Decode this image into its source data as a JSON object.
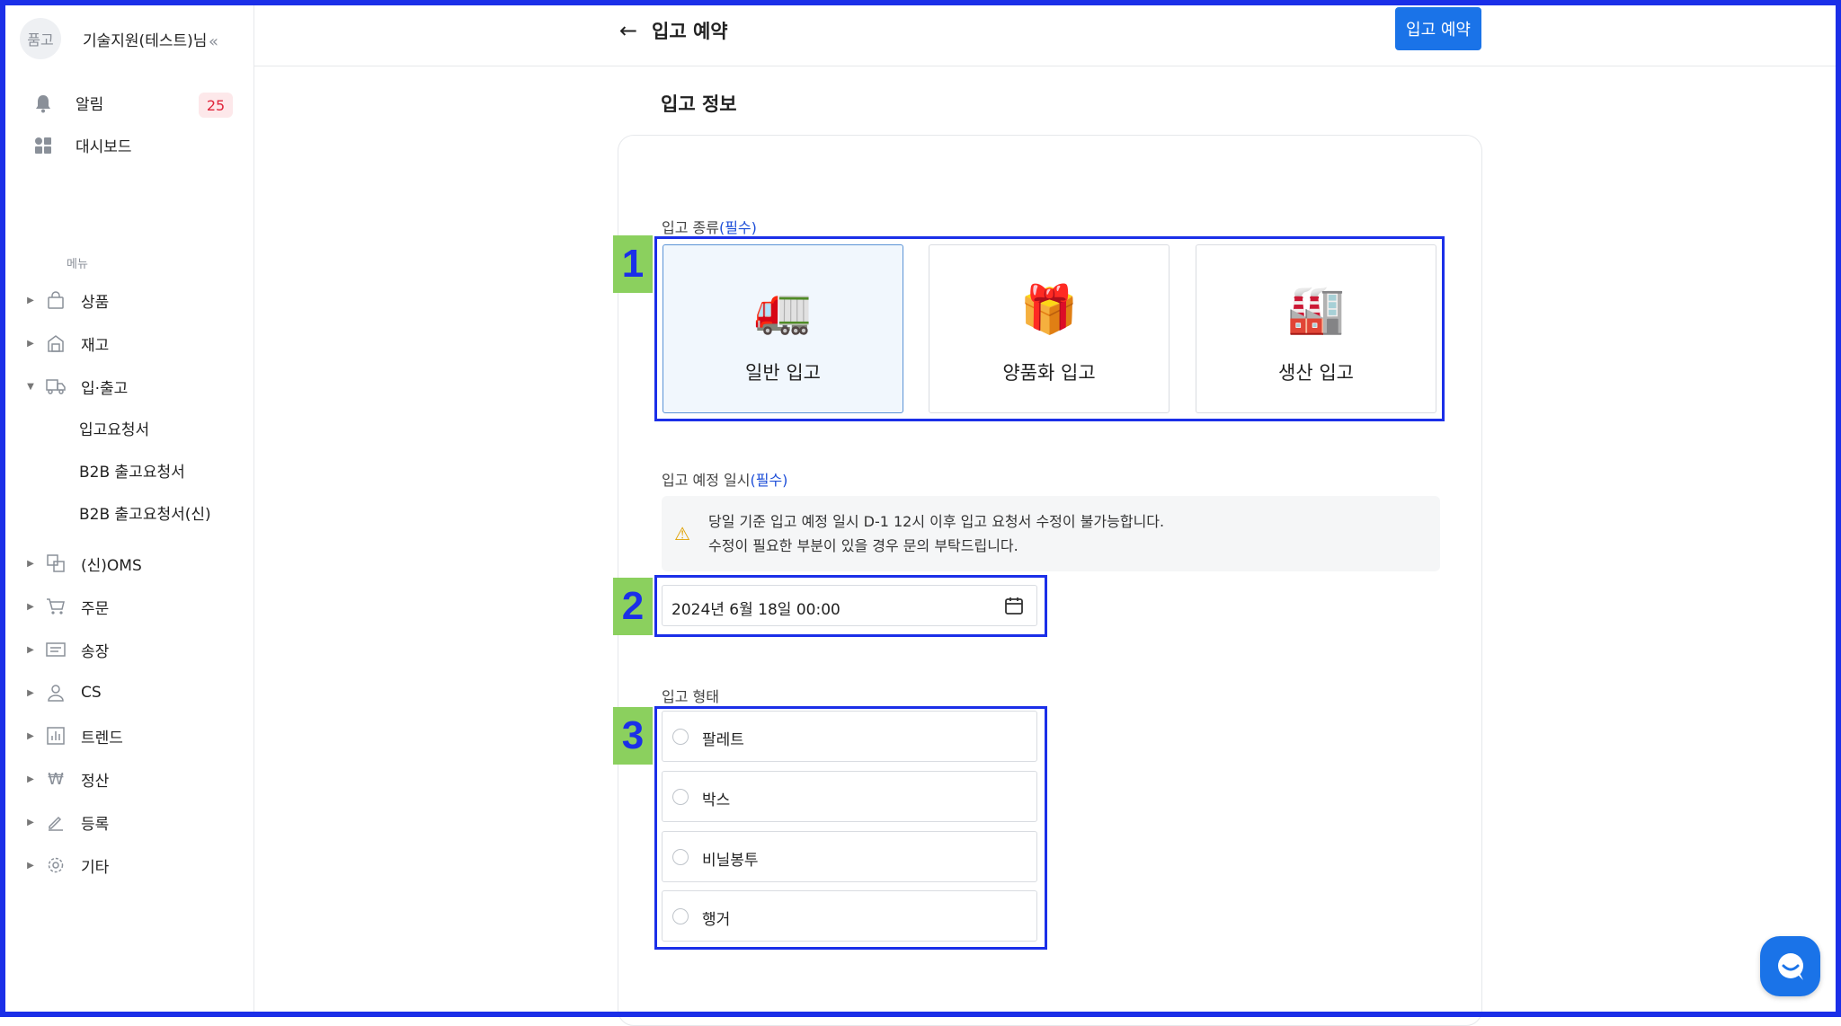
{
  "sidebar": {
    "avatar_text": "품고",
    "user_name": "기술지원(테스트)님",
    "collapse_icon": "double-chevron-left-icon",
    "notifications": {
      "label": "알림",
      "count": "25"
    },
    "dashboard": {
      "label": "대시보드"
    },
    "menu_section": "메뉴",
    "items": [
      {
        "label": "상품",
        "icon": "bag-icon"
      },
      {
        "label": "재고",
        "icon": "warehouse-icon"
      },
      {
        "label": "입·출고",
        "icon": "truck-icon",
        "expanded": true
      },
      {
        "label": "(신)OMS",
        "icon": "oms-icon"
      },
      {
        "label": "주문",
        "icon": "cart-icon"
      },
      {
        "label": "송장",
        "icon": "invoice-icon"
      },
      {
        "label": "CS",
        "icon": "person-icon"
      },
      {
        "label": "트렌드",
        "icon": "chart-icon"
      },
      {
        "label": "정산",
        "icon": "won-icon"
      },
      {
        "label": "등록",
        "icon": "pencil-icon"
      },
      {
        "label": "기타",
        "icon": "gear-icon"
      }
    ],
    "sub_items": [
      {
        "label": "입고요청서"
      },
      {
        "label": "B2B 출고요청서"
      },
      {
        "label": "B2B 출고요청서(신)"
      }
    ]
  },
  "header": {
    "back_icon": "←",
    "title": "입고 예약",
    "action_button": "입고 예약"
  },
  "main": {
    "section_title": "입고 정보",
    "inbound_type": {
      "label": "입고 종류",
      "required": "(필수)",
      "options": [
        {
          "emoji": "🚛",
          "label": "일반 입고",
          "selected": true
        },
        {
          "emoji": "🎁",
          "label": "양품화 입고",
          "selected": false
        },
        {
          "emoji": "🏭",
          "label": "생산 입고",
          "selected": false
        }
      ]
    },
    "schedule": {
      "label": "입고 예정 일시",
      "required": "(필수)",
      "notice_icon": "⚠",
      "notice_line1": "당일 기준 입고 예정 일시 D-1 12시 이후 입고 요청서 수정이 불가능합니다.",
      "notice_line2": "수정이 필요한 부분이 있을 경우 문의 부탁드립니다.",
      "value": "2024년 6월 18일 00:00"
    },
    "form_type": {
      "label": "입고 형태",
      "options": [
        "팔레트",
        "박스",
        "비닐봉투",
        "행거"
      ]
    }
  },
  "annotations": [
    "1",
    "2",
    "3"
  ],
  "colors": {
    "primary": "#1a73e8",
    "highlight_border": "#1b2fe8",
    "tag_bg": "#8bd05e",
    "badge_bg": "#fde8ea",
    "badge_text": "#e0243a",
    "required": "#1d4ed8"
  }
}
